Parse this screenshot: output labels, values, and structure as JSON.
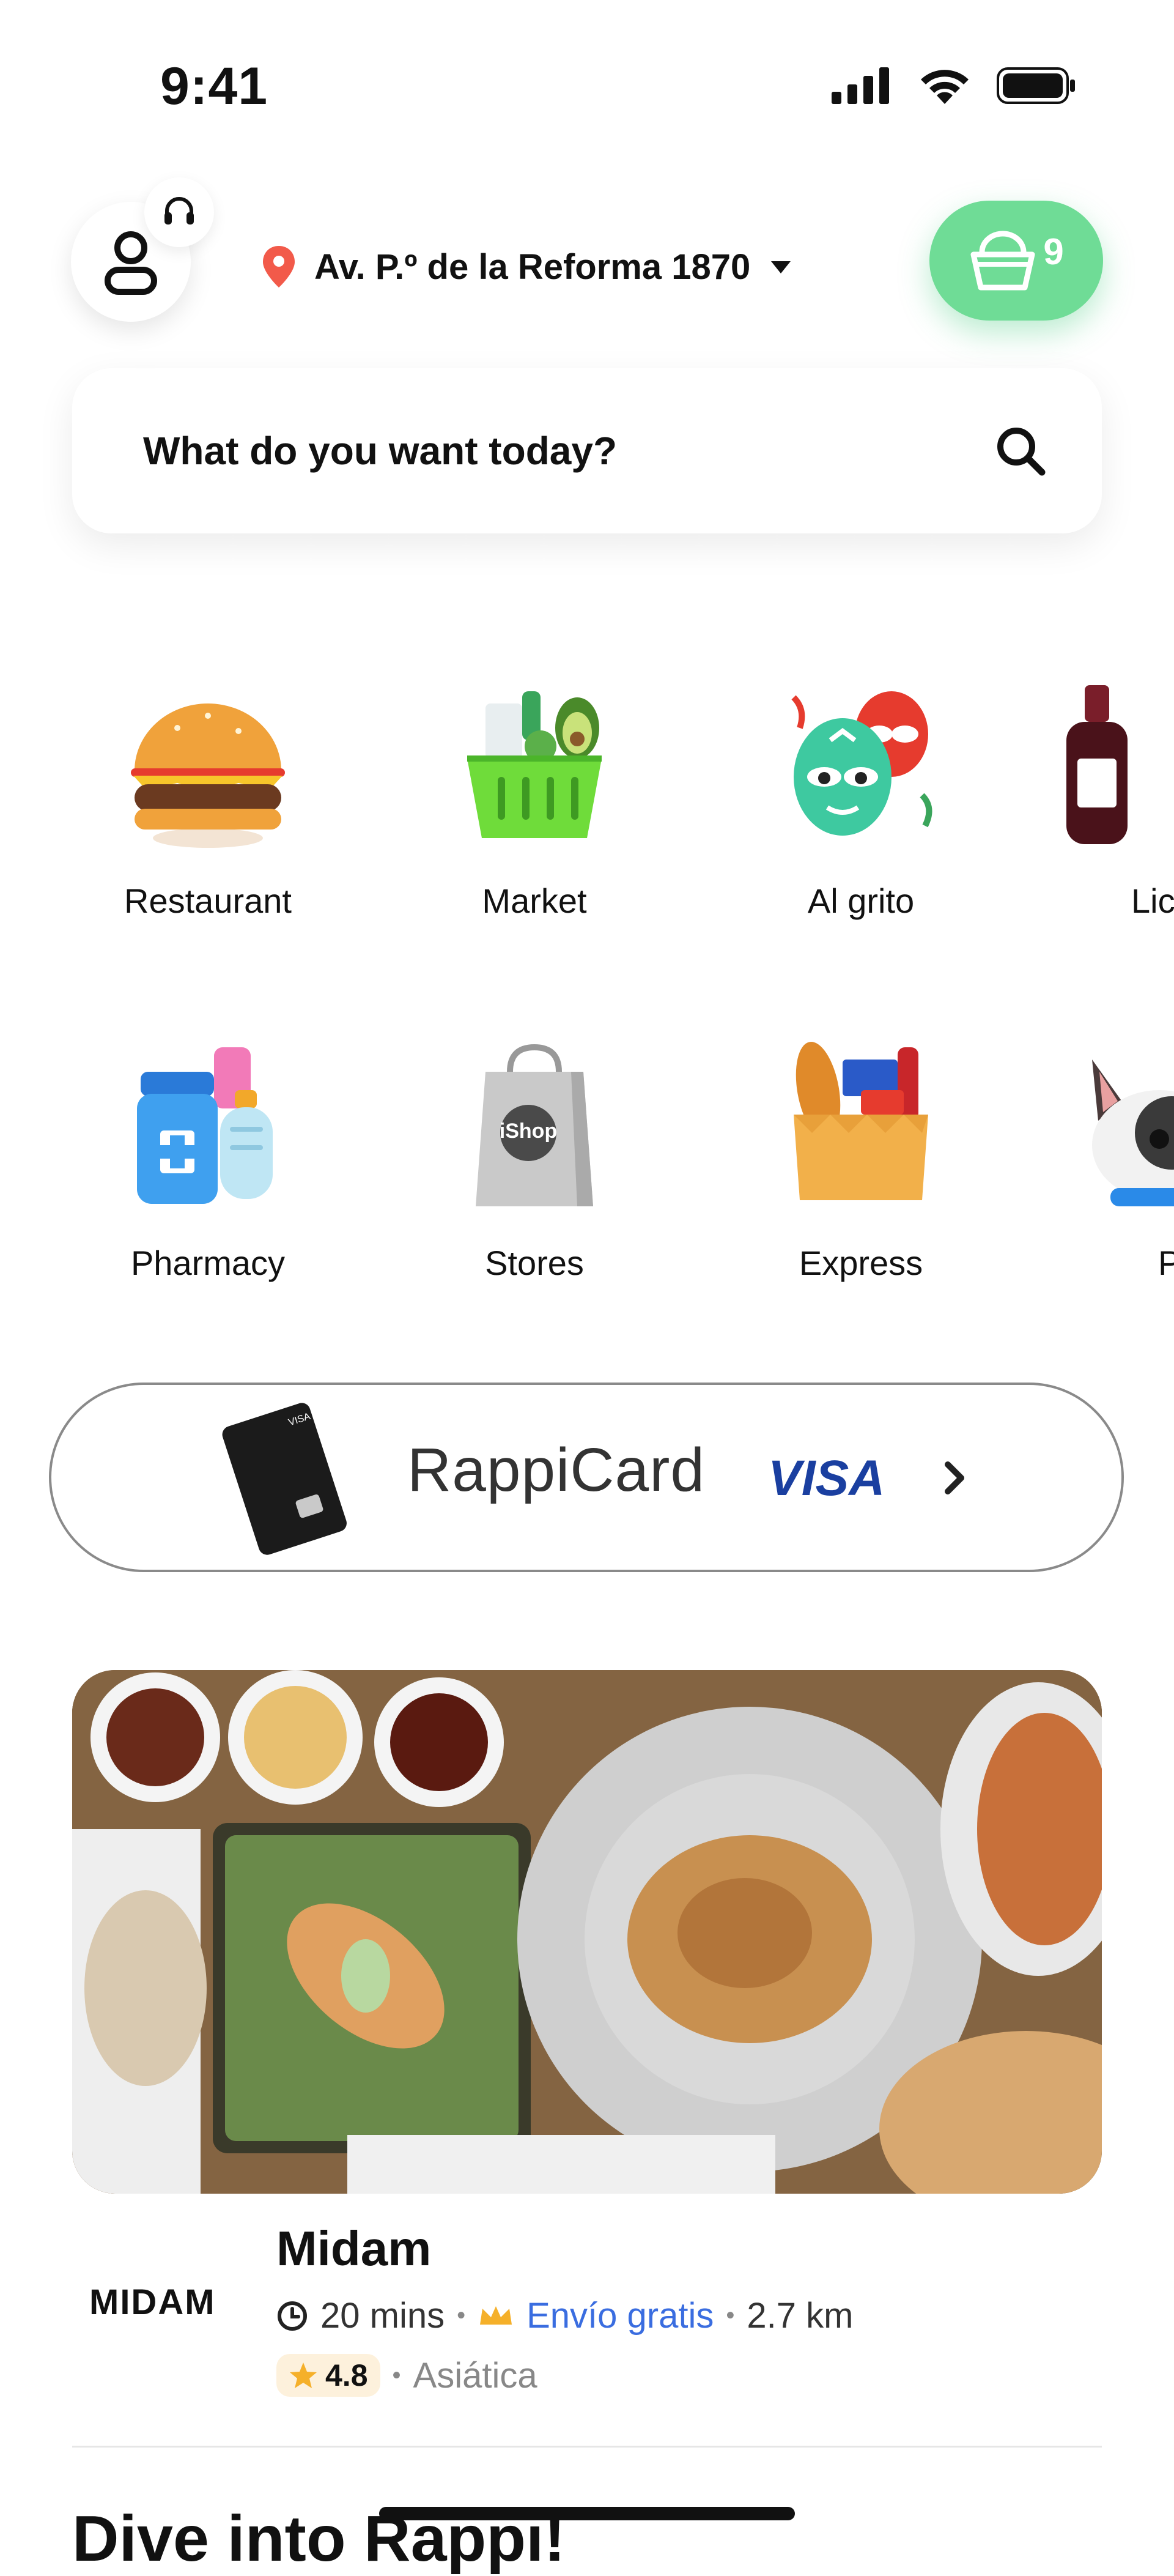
{
  "status_bar": {
    "time": "9:41"
  },
  "header": {
    "address": "Av. P.º de la Reforma 1870",
    "cart_count": "9"
  },
  "search": {
    "placeholder": "What do you want today?"
  },
  "categories": [
    {
      "label": "Restaurant"
    },
    {
      "label": "Market"
    },
    {
      "label": "Al grito"
    },
    {
      "label": "Lic"
    },
    {
      "label": "Pharmacy"
    },
    {
      "label": "Stores"
    },
    {
      "label": "Express"
    },
    {
      "label": "P"
    }
  ],
  "stores_bag_text": "iShop",
  "promo": {
    "brand": "RappiCard",
    "network": "VISA"
  },
  "restaurant": {
    "logo_text": "MIDAM",
    "name": "Midam",
    "time": "20 mins",
    "shipping": "Envío gratis",
    "distance": "2.7 km",
    "rating": "4.8",
    "cuisine": "Asiática"
  },
  "section": {
    "title": "Dive into Rappi!"
  },
  "colors": {
    "accent_green": "#6fdc96",
    "link_blue": "#3a6de0",
    "visa_blue": "#1a3fa0"
  }
}
